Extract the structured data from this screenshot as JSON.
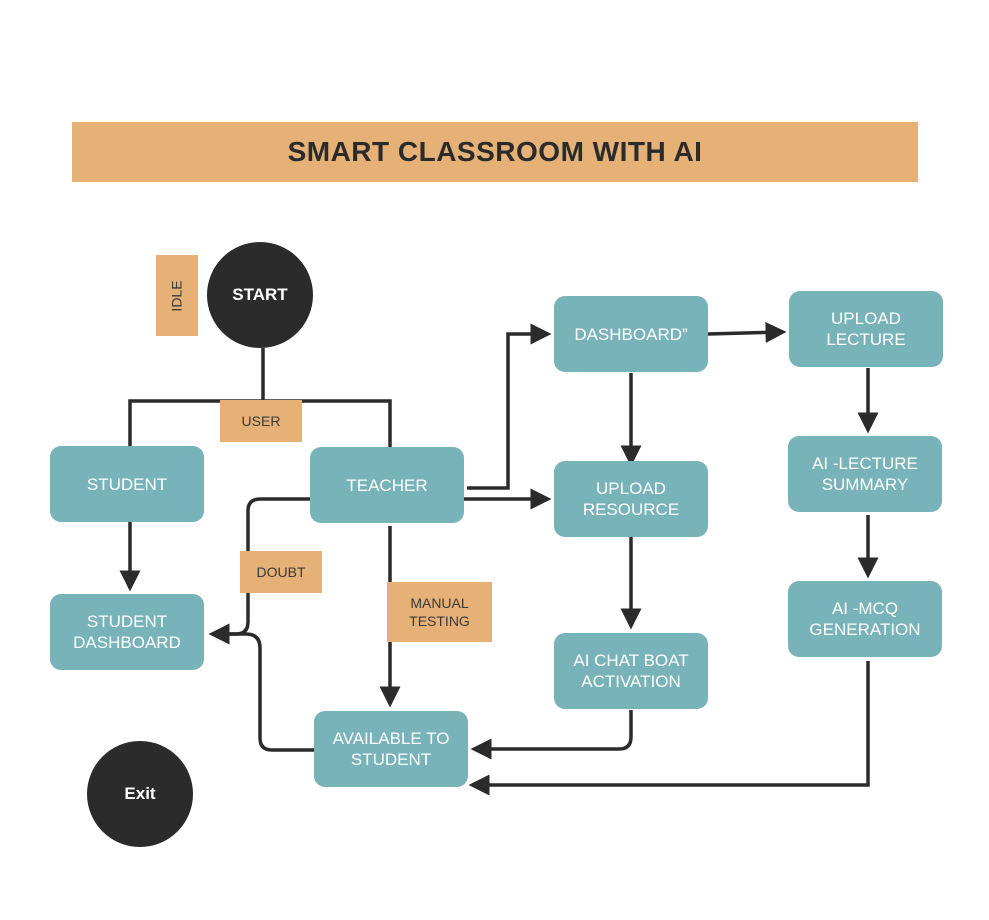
{
  "title": "SMART CLASSROOM WITH AI",
  "nodes": {
    "start": "START",
    "exit": "Exit",
    "student": "STUDENT",
    "teacher": "TEACHER",
    "student_dashboard": "STUDENT\nDASHBOARD",
    "available": "AVAILABLE TO\nSTUDENT",
    "dashboard": "DASHBOARD”",
    "upload_resource": "UPLOAD\nRESOURCE",
    "chat_boat": "AI CHAT BOAT\nACTIVATION",
    "upload_lecture": "UPLOAD\nLECTURE",
    "lecture_summary": "AI -LECTURE\nSUMMARY",
    "mcq": "AI -MCQ\nGENERATION"
  },
  "labels": {
    "idle": "IDLE",
    "user": "USER",
    "doubt": "DOUBT",
    "manual_testing": "MANUAL\nTESTING"
  },
  "colors": {
    "node": "#78B3BA",
    "label": "#E6B176",
    "dark": "#2b2b2b"
  }
}
